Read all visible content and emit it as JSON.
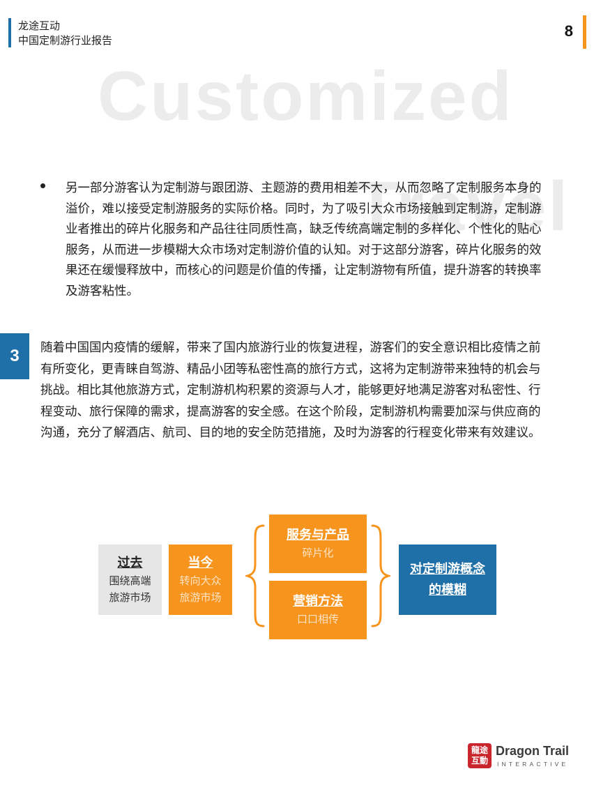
{
  "header": {
    "company": "龙途互动",
    "report_title": "中国定制游行业报告",
    "page_number": "8"
  },
  "watermark": {
    "line1": "Customized",
    "line2": "Travel"
  },
  "paragraph1": "另一部分游客认为定制游与跟团游、主题游的费用相差不大，从而忽略了定制服务本身的溢价，难以接受定制游服务的实际价格。同时，为了吸引大众市场接触到定制游，定制游业者推出的碎片化服务和产品往往同质性高，缺乏传统高端定制的多样化、个性化的贴心服务，从而进一步模糊大众市场对定制游价值的认知。对于这部分游客，碎片化服务的效果还在缓慢释放中，而核心的问题是价值的传播，让定制游物有所值，提升游客的转换率及游客粘性。",
  "section": {
    "number": "3",
    "paragraph": "随着中国国内疫情的缓解，带来了国内旅游行业的恢复进程，游客们的安全意识相比疫情之前有所变化，更青睐自驾游、精品小团等私密性高的旅行方式，这将为定制游带来独特的机会与挑战。相比其他旅游方式，定制游机构积累的资源与人才，能够更好地满足游客对私密性、行程变动、旅行保障的需求，提高游客的安全感。在这个阶段，定制游机构需要加深与供应商的沟通，充分了解酒店、航司、目的地的安全防范措施，及时为游客的行程变化带来有效建议。"
  },
  "diagram": {
    "past": {
      "title": "过去",
      "line1": "围绕高端",
      "line2": "旅游市场"
    },
    "now": {
      "title": "当今",
      "line1": "转向大众",
      "line2": "旅游市场"
    },
    "service": {
      "title": "服务与产品",
      "sub": "碎片化"
    },
    "marketing": {
      "title": "营销方法",
      "sub": "口口相传"
    },
    "result": {
      "line1": "对定制游概念",
      "line2": "的模糊"
    }
  },
  "logo": {
    "mark_top": "龍途",
    "mark_bottom": "互動",
    "name": "Dragon Trail",
    "sub": "INTERACTIVE"
  },
  "colors": {
    "accent_orange": "#f7941d",
    "brand_blue": "#1f6fa8",
    "past_gray": "#e6e6e6",
    "logo_red": "#c8252c"
  }
}
